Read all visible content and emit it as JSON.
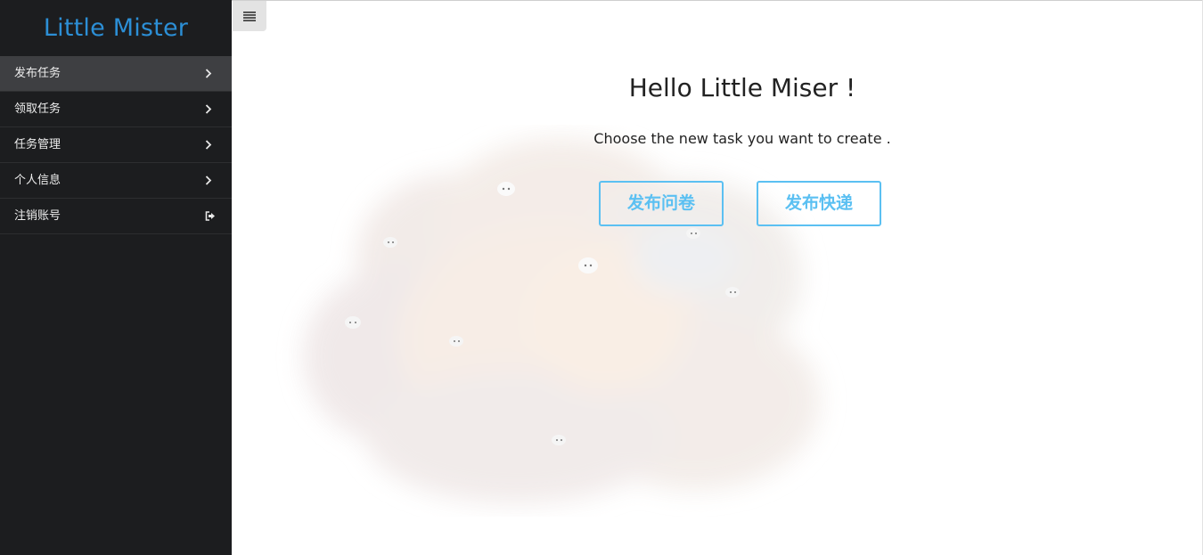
{
  "sidebar": {
    "brand": "Little Mister",
    "items": [
      {
        "label": "发布任务",
        "icon": "chevron-right-icon"
      },
      {
        "label": "领取任务",
        "icon": "chevron-right-icon"
      },
      {
        "label": "任务管理",
        "icon": "chevron-right-icon"
      },
      {
        "label": "个人信息",
        "icon": "chevron-right-icon"
      },
      {
        "label": "注销账号",
        "icon": "sign-out-icon"
      }
    ],
    "active_index": 0
  },
  "toolbar": {
    "toggle_icon": "hamburger-menu-icon"
  },
  "main": {
    "title": "Hello Little Miser !",
    "subtitle": "Choose the new task you want to create .",
    "buttons": {
      "survey": "发布问卷",
      "express": "发布快递"
    }
  },
  "colors": {
    "sidebar_bg": "#1c1d1f",
    "sidebar_active": "#3e3f42",
    "brand": "#2c8fd6",
    "accent": "#5bc0f2"
  }
}
